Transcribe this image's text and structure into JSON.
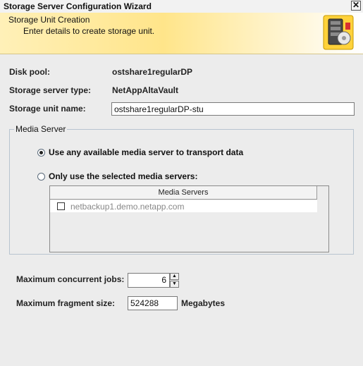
{
  "window": {
    "title": "Storage Server Configuration Wizard",
    "close_glyph": "✕"
  },
  "banner": {
    "title": "Storage Unit Creation",
    "subtitle": "Enter details to create storage unit.",
    "icon": "storage-disk-icon"
  },
  "fields": {
    "disk_pool_label": "Disk pool:",
    "disk_pool_value": "ostshare1regularDP",
    "server_type_label": "Storage server type:",
    "server_type_value": "NetAppAltaVault",
    "unit_name_label": "Storage unit name:",
    "unit_name_value": "ostshare1regularDP-stu"
  },
  "media_server": {
    "legend": "Media Server",
    "option_any_label": "Use any available media server to transport data",
    "option_any_selected": true,
    "option_selected_label": "Only use the selected media servers:",
    "option_selected_selected": false,
    "table": {
      "header": "Media Servers",
      "rows": [
        {
          "name": "netbackup1.demo.netapp.com",
          "checked": false
        }
      ]
    }
  },
  "limits": {
    "max_jobs_label": "Maximum concurrent jobs:",
    "max_jobs_value": "6",
    "max_fragment_label": "Maximum fragment size:",
    "max_fragment_value": "524288",
    "max_fragment_unit": "Megabytes"
  }
}
